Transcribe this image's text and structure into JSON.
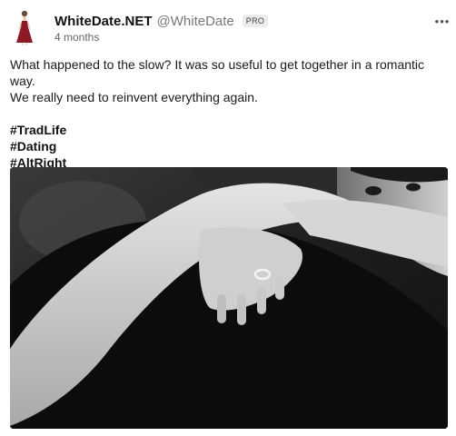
{
  "author": {
    "display_name": "WhiteDate.NET",
    "handle": "@WhiteDate",
    "badge": "PRO",
    "avatar_icon": "woman-in-red-dress-avatar"
  },
  "post": {
    "timestamp": "4 months",
    "text_line_1": "What happened to the slow? It was so useful to get together in a romantic way.",
    "text_line_2": "We really need to reinvent everything again.",
    "hashtags": [
      "#TradLife",
      "#Dating",
      "#AltRight"
    ],
    "more_icon": "more-horizontal-icon",
    "image_description_icon": "embracing-couple-photo"
  },
  "colors": {
    "accent_dress": "#8b1a24",
    "text_primary": "#111111",
    "text_muted": "#777777"
  }
}
